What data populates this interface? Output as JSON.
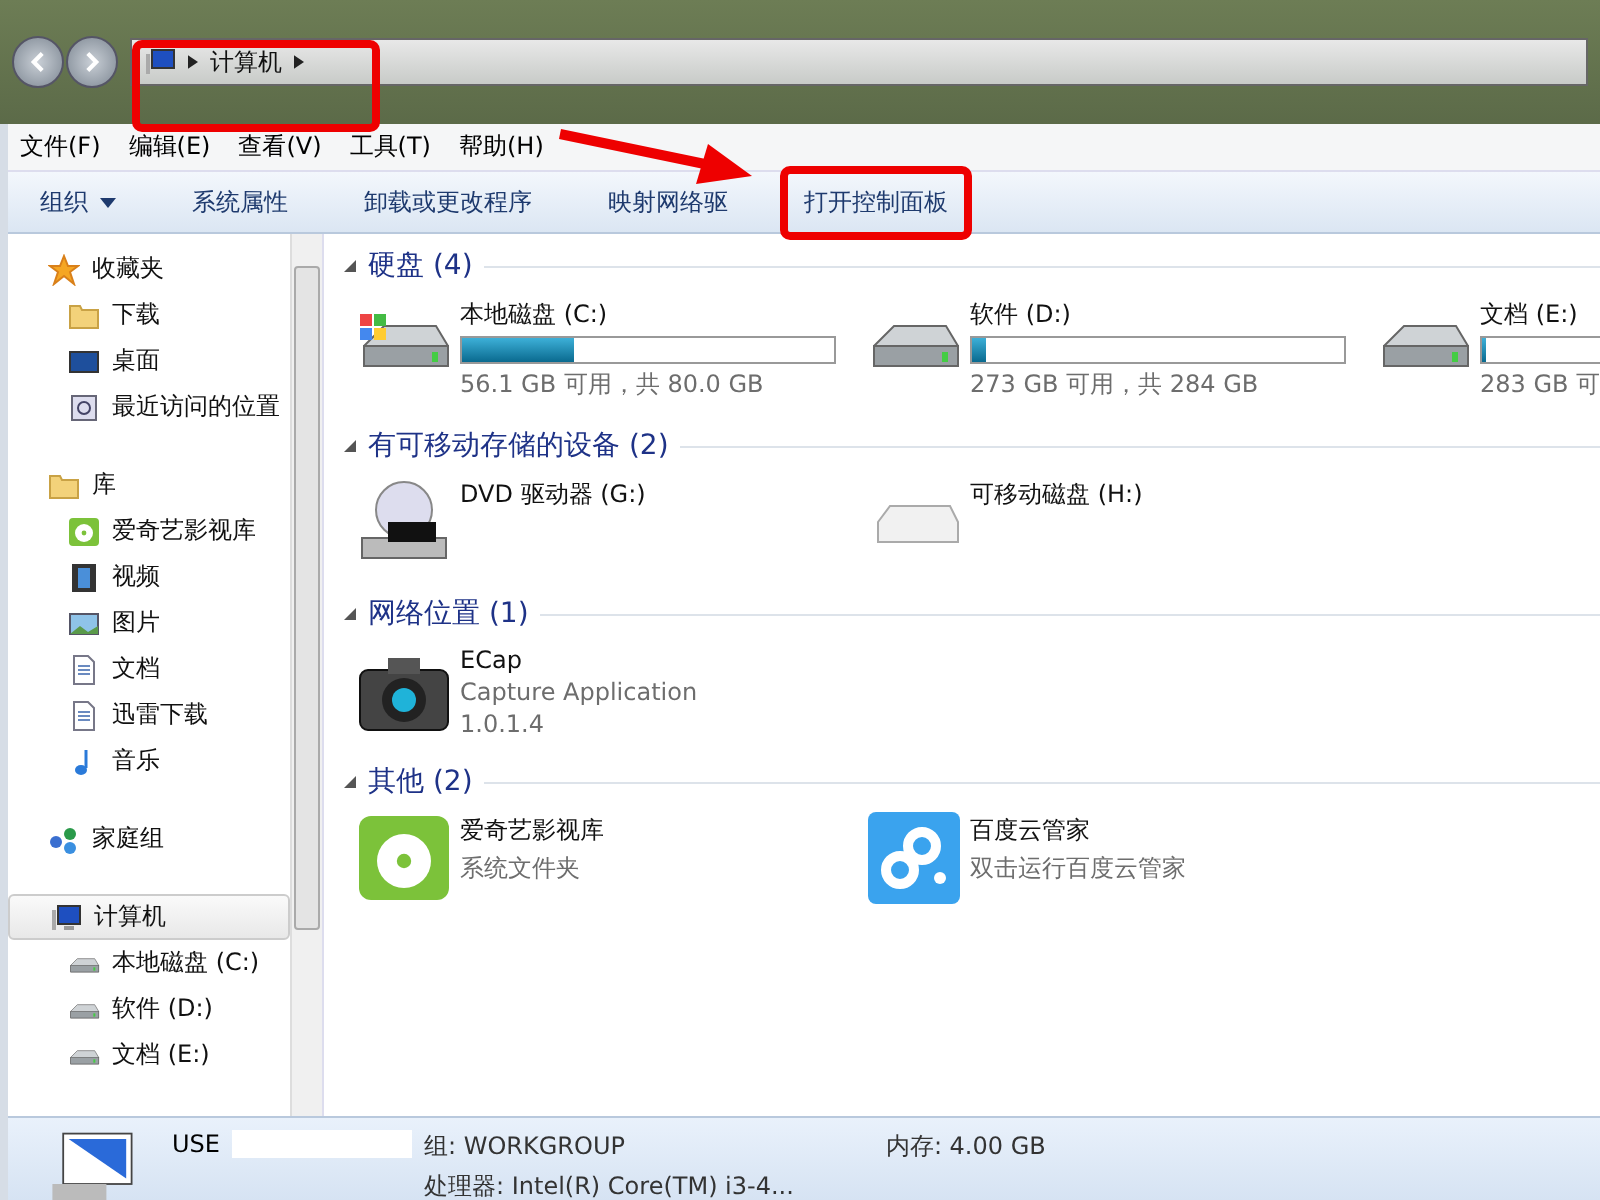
{
  "address": {
    "crumbs": [
      "计算机"
    ]
  },
  "menu": [
    "文件(F)",
    "编辑(E)",
    "查看(V)",
    "工具(T)",
    "帮助(H)"
  ],
  "toolbar": [
    {
      "label": "组织",
      "dropdown": true,
      "highlighted": false
    },
    {
      "label": "系统属性",
      "dropdown": false,
      "highlighted": false
    },
    {
      "label": "卸载或更改程序",
      "dropdown": false,
      "highlighted": false
    },
    {
      "label": "映射网络驱",
      "dropdown": false,
      "highlighted": false
    },
    {
      "label": "打开控制面板",
      "dropdown": false,
      "highlighted": true
    }
  ],
  "sidebar": [
    {
      "label": "收藏夹",
      "selected": false,
      "children": [
        {
          "label": "下载",
          "selected": false
        },
        {
          "label": "桌面",
          "selected": false
        },
        {
          "label": "最近访问的位置",
          "selected": false
        }
      ]
    },
    {
      "label": "库",
      "selected": false,
      "children": [
        {
          "label": "爱奇艺影视库",
          "selected": false
        },
        {
          "label": "视频",
          "selected": false
        },
        {
          "label": "图片",
          "selected": false
        },
        {
          "label": "文档",
          "selected": false
        },
        {
          "label": "迅雷下载",
          "selected": false
        },
        {
          "label": "音乐",
          "selected": false
        }
      ]
    },
    {
      "label": "家庭组",
      "selected": false
    },
    {
      "label": "计算机",
      "selected": true,
      "children": [
        {
          "label": "本地磁盘 (C:)",
          "selected": false
        },
        {
          "label": "软件 (D:)",
          "selected": false
        },
        {
          "label": "文档 (E:)",
          "selected": false
        }
      ]
    }
  ],
  "sections": [
    {
      "title": "硬盘 (4)",
      "items": [
        {
          "kind": "drive",
          "name": "本地磁盘 (C:)",
          "level": 0.3,
          "reading": "56.1 GB 可用，共 80.0 GB"
        },
        {
          "kind": "drive",
          "name": "软件 (D:)",
          "level": 0.04,
          "reading": "273 GB 可用，共 284 GB"
        },
        {
          "kind": "drive",
          "name": "文档 (E:)",
          "level": 0.01,
          "reading": "283 GB 可"
        }
      ]
    },
    {
      "title": "有可移动存储的设备 (2)",
      "items": [
        {
          "kind": "device",
          "name": "DVD 驱动器 (G:)"
        },
        {
          "kind": "device",
          "name": "可移动磁盘 (H:)"
        }
      ]
    },
    {
      "title": "网络位置 (1)",
      "items": [
        {
          "kind": "app",
          "name": "ECap",
          "lines": [
            "Capture Application",
            "1.0.1.4"
          ]
        }
      ]
    },
    {
      "title": "其他 (2)",
      "items": [
        {
          "kind": "app",
          "name": "爱奇艺影视库",
          "lines": [
            "系统文件夹"
          ]
        },
        {
          "kind": "app",
          "name": "百度云管家",
          "lines": [
            "双击运行百度云管家"
          ]
        }
      ]
    }
  ],
  "status": {
    "name": "USE",
    "workgroup": "组: WORKGROUP",
    "memory": "内存: 4.00 GB",
    "cpu": "处理器: Intel(R) Core(TM) i3-4..."
  }
}
